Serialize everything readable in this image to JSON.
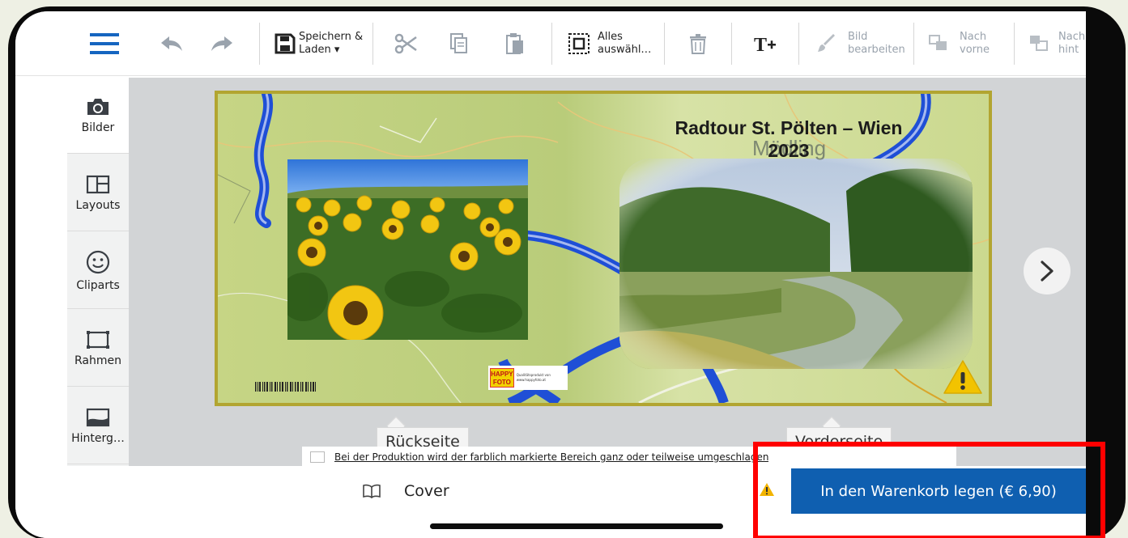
{
  "toolbar": {
    "save_label_1": "Speichern &",
    "save_label_2": "Laden ▾",
    "select_all_1": "Alles",
    "select_all_2": "auswähl…",
    "edit_image_1": "Bild",
    "edit_image_2": "bearbeiten",
    "to_front_1": "Nach",
    "to_front_2": "vorne",
    "to_back_1": "Nach",
    "to_back_2": "hint"
  },
  "sidebar": {
    "items": [
      {
        "label": "Bilder",
        "icon": "camera-icon"
      },
      {
        "label": "Layouts",
        "icon": "layout-icon"
      },
      {
        "label": "Cliparts",
        "icon": "smiley-icon"
      },
      {
        "label": "Rahmen",
        "icon": "frame-icon"
      },
      {
        "label": "Hinterg…",
        "icon": "background-icon"
      }
    ]
  },
  "cover": {
    "title": "Radtour St. Pölten – Wien",
    "year": "2023",
    "map_town": "Mödling",
    "logo_text": "HAPPY FOTO",
    "logo_small": "Qualitätsprodukt von www.happyfoto.at"
  },
  "labels": {
    "back": "Rückseite",
    "front": "Vorderseite"
  },
  "notice": "Bei der Produktion wird der farblich markierte Bereich ganz oder teilweise umgeschlagen",
  "bottom": {
    "cover_label": "Cover",
    "cart_button": "In den Warenkorb legen (€ 6,90)"
  },
  "colors": {
    "primary": "#0f5fb0",
    "highlight": "#ff0000",
    "warning": "#f2c300",
    "route": "#1f4fd6"
  }
}
